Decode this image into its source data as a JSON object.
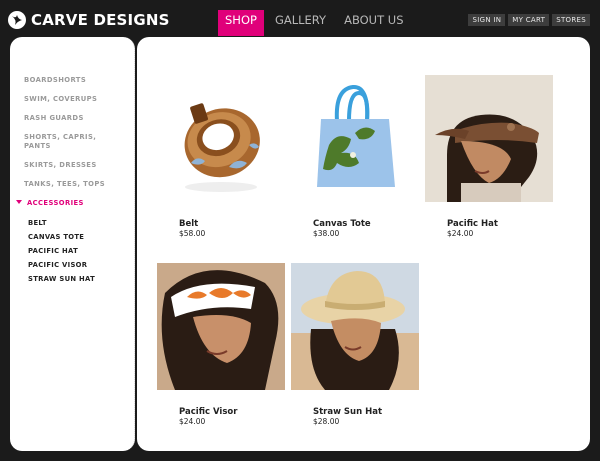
{
  "brand": {
    "name": "CARVE DESIGNS"
  },
  "nav": {
    "items": [
      {
        "label": "SHOP",
        "active": true
      },
      {
        "label": "GALLERY",
        "active": false
      },
      {
        "label": "ABOUT US",
        "active": false
      }
    ]
  },
  "util_nav": [
    "SIGN IN",
    "MY CART",
    "STORES"
  ],
  "sidebar": {
    "categories": [
      {
        "label": "BOARDSHORTS"
      },
      {
        "label": "SWIM, COVERUPS"
      },
      {
        "label": "RASH GUARDS"
      },
      {
        "label": "SHORTS, CAPRIS, PANTS"
      },
      {
        "label": "SKIRTS, DRESSES"
      },
      {
        "label": "TANKS, TEES, TOPS"
      },
      {
        "label": "ACCESSORIES",
        "active": true
      }
    ],
    "subcategories": [
      "BELT",
      "CANVAS TOTE",
      "PACIFIC HAT",
      "PACIFIC VISOR",
      "STRAW SUN HAT"
    ]
  },
  "products": [
    {
      "name": "Belt",
      "price": "$58.00",
      "image": "belt-image"
    },
    {
      "name": "Canvas Tote",
      "price": "$38.00",
      "image": "tote-image"
    },
    {
      "name": "Pacific Hat",
      "price": "$24.00",
      "image": "hat-image"
    },
    {
      "name": "Pacific Visor",
      "price": "$24.00",
      "image": "visor-image"
    },
    {
      "name": "Straw Sun Hat",
      "price": "$28.00",
      "image": "straw-hat-image"
    }
  ],
  "colors": {
    "accent": "#e0007a",
    "background": "#1b1b1b",
    "panel": "#ffffff"
  }
}
